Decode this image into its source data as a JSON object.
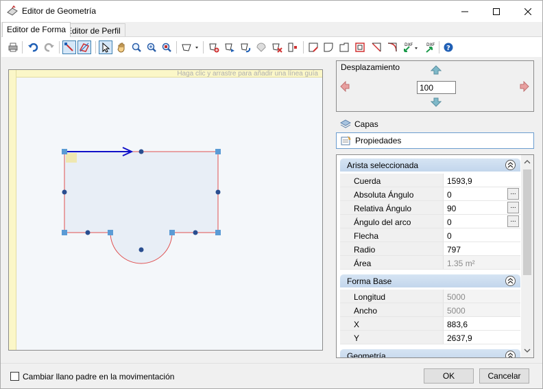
{
  "window": {
    "title": "Editor de Geometría",
    "minimize": "minimize-icon",
    "maximize": "maximize-icon",
    "close": "close-icon"
  },
  "tabs": [
    {
      "label": "Editor de Forma",
      "active": true
    },
    {
      "label": "Editor de Perfil",
      "active": false
    }
  ],
  "canvas": {
    "ruler_hint": "Haga clic y arrastre para añadir una línea guía"
  },
  "navigation": {
    "title": "Desplazamiento",
    "step_value": "100"
  },
  "panels": {
    "layers": "Capas",
    "properties": "Propiedades"
  },
  "properties": {
    "selected_edge": {
      "title": "Arista seleccionada",
      "rows": [
        {
          "name": "Cuerda",
          "value": "1593,9"
        },
        {
          "name": "Absoluta Ángulo",
          "value": "0",
          "button": "..."
        },
        {
          "name": "Relativa Ángulo",
          "value": "90",
          "button": "..."
        },
        {
          "name": "Ángulo del arco",
          "value": "0",
          "button": "..."
        },
        {
          "name": "Flecha",
          "value": "0"
        },
        {
          "name": "Radio",
          "value": "797"
        },
        {
          "name": "Área",
          "value": "1.35 m²"
        }
      ]
    },
    "base_shape": {
      "title": "Forma Base",
      "rows": [
        {
          "name": "Longitud",
          "value": "5000"
        },
        {
          "name": "Ancho",
          "value": "5000"
        },
        {
          "name": "X",
          "value": "883,6"
        },
        {
          "name": "Y",
          "value": "2637,9"
        }
      ]
    },
    "geometry": {
      "title": "Geometría"
    }
  },
  "footer": {
    "checkbox_label": "Cambiar llano padre en la movimentación",
    "ok": "OK",
    "cancel": "Cancelar"
  },
  "colors": {
    "accent": "#2a6fd6",
    "shape_fill": "#e8eef6",
    "shape_edge": "#e05050",
    "selected_edge": "#1010c8",
    "handle": "#5b9bd5"
  }
}
